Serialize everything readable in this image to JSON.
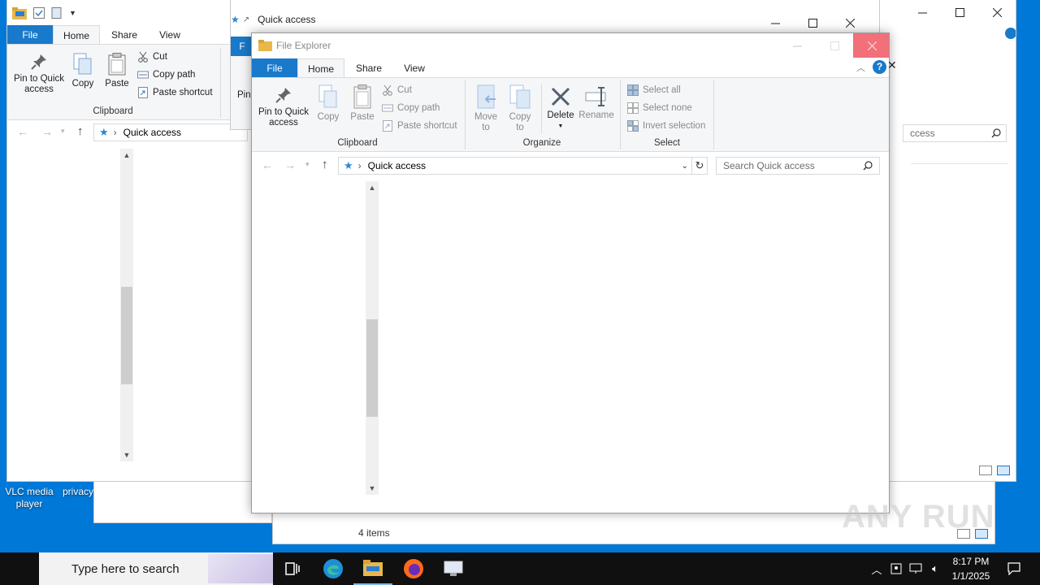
{
  "desktop": {
    "icons": [
      {
        "label_line1": "VLC media",
        "label_line2": "player"
      },
      {
        "label_line1": "privacy",
        "label_line2": ""
      }
    ],
    "watermark": "ANY RUN"
  },
  "win_left": {
    "tabs": {
      "file": "File",
      "home": "Home",
      "share": "Share",
      "view": "View"
    },
    "ribbon": {
      "pin": "Pin to Quick access",
      "copy": "Copy",
      "paste": "Paste",
      "cut": "Cut",
      "copy_path": "Copy path",
      "paste_shortcut": "Paste shortcut",
      "group_clipboard": "Clipboard"
    },
    "address": "Quick access"
  },
  "win_middle": {
    "title": "Quick access",
    "tab_file_partial": "F",
    "pin_partial": "Pin"
  },
  "win_right": {
    "search_partial": "ccess"
  },
  "win_back_bottom": {
    "status": "4 items"
  },
  "win_front": {
    "title": "File Explorer",
    "tabs": {
      "file": "File",
      "home": "Home",
      "share": "Share",
      "view": "View"
    },
    "ribbon": {
      "pin": "Pin to Quick access",
      "copy": "Copy",
      "paste": "Paste",
      "cut": "Cut",
      "copy_path": "Copy path",
      "paste_shortcut": "Paste shortcut",
      "group_clipboard": "Clipboard",
      "move_to": "Move to",
      "copy_to": "Copy to",
      "delete": "Delete",
      "rename": "Rename",
      "group_organize": "Organize",
      "select_all": "Select all",
      "select_none": "Select none",
      "invert_selection": "Invert selection",
      "group_select": "Select"
    },
    "address": "Quick access",
    "search_placeholder": "Search Quick access"
  },
  "taskbar": {
    "search_placeholder": "Type here to search",
    "time": "8:17 PM",
    "date": "1/1/2025"
  },
  "colors": {
    "desktop": "#0078d7",
    "accent": "#1979ca",
    "close_hover": "#f1707a",
    "taskbar": "#101010"
  }
}
